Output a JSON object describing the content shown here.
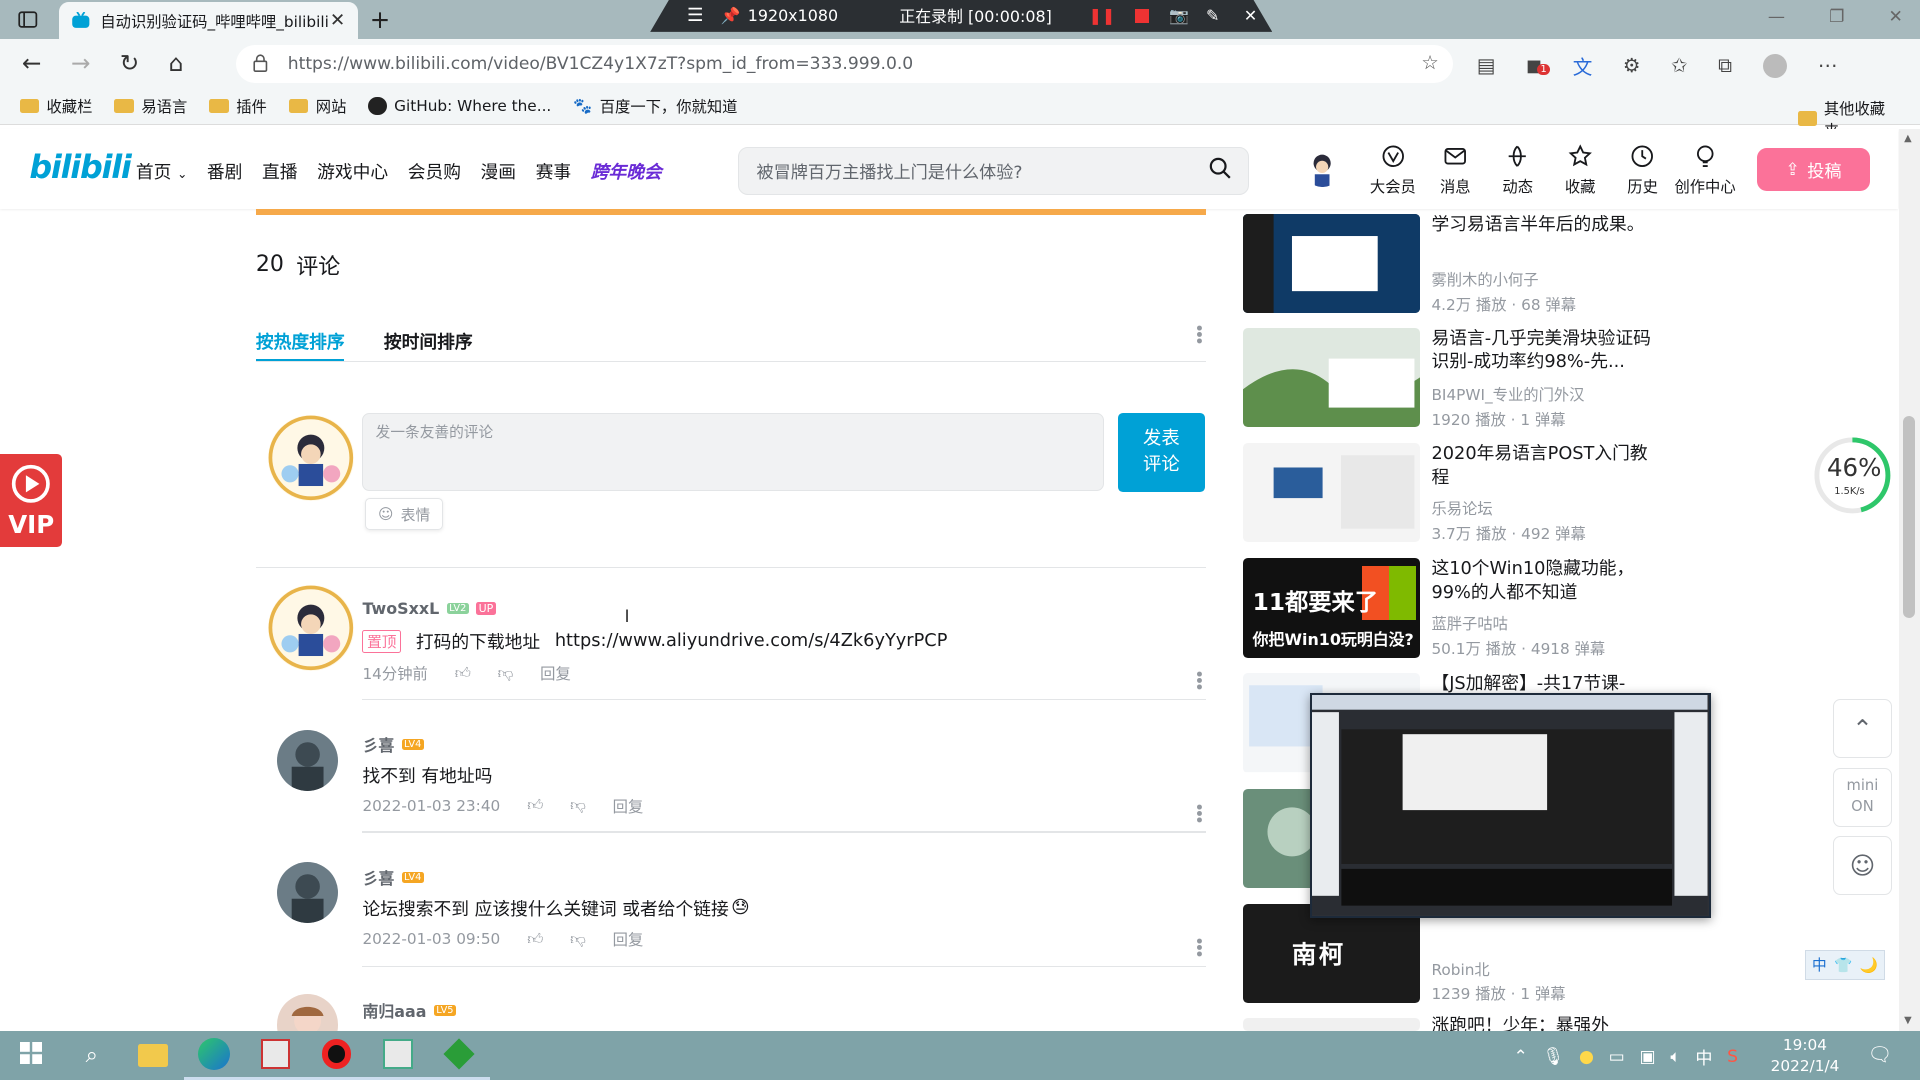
{
  "browser": {
    "tab_title": "自动识别验证码_哔哩哔哩_bilibili",
    "recorder": {
      "resolution": "1920x1080",
      "status": "正在录制 [00:00:08]"
    },
    "url": "https://www.bilibili.com/video/BV1CZ4y1X7zT?spm_id_from=333.999.0.0",
    "bookmarks": [
      "收藏栏",
      "易语言",
      "插件",
      "网站",
      "GitHub: Where the...",
      "百度一下，你就知道"
    ],
    "other_bookmarks": "其他收藏夹"
  },
  "site": {
    "logo": "bilibili",
    "nav": [
      "首页",
      "番剧",
      "直播",
      "游戏中心",
      "会员购",
      "漫画",
      "赛事",
      "跨年晚会"
    ],
    "search_placeholder": "被冒牌百万主播找上门是什么体验?",
    "user_icons": [
      {
        "label": "大会员",
        "icon": "vip-icon"
      },
      {
        "label": "消息",
        "icon": "message-icon"
      },
      {
        "label": "动态",
        "icon": "dynamic-icon"
      },
      {
        "label": "收藏",
        "icon": "star-icon"
      },
      {
        "label": "历史",
        "icon": "history-icon"
      },
      {
        "label": "创作中心",
        "icon": "bulb-icon"
      }
    ],
    "upload_label": "投稿"
  },
  "comments": {
    "count": "20",
    "count_label": "评论",
    "sort_hot": "按热度排序",
    "sort_time": "按时间排序",
    "input_placeholder": "发一条友善的评论",
    "submit_label": "发表\n评论",
    "emoji_label": "表情",
    "reply_label": "回复",
    "items": [
      {
        "user": "TwoSxxL",
        "level": "LV2",
        "badge": "UP",
        "pinned": "置顶",
        "text": "打码的下载地址",
        "link": "https://www.aliyundrive.com/s/4Zk6yYyrPCP",
        "time": "14分钟前"
      },
      {
        "user": "彡喜",
        "level": "LV4",
        "text": "找不到   有地址吗",
        "time": "2022-01-03 23:40"
      },
      {
        "user": "彡喜",
        "level": "LV4",
        "text": "论坛搜索不到   应该搜什么关键词    或者给个链接",
        "time": "2022-01-03 09:50"
      },
      {
        "user": "南归aaa",
        "level": "LV5"
      }
    ]
  },
  "related": [
    {
      "title": "学习易语言半年后的成果。",
      "up": "雾削木的小何子",
      "stats": "4.2万 播放 · 68 弹幕"
    },
    {
      "title": "易语言-几乎完美滑块验证码识别-成功率约98%-先...",
      "up": "BI4PWI_专业的门外汉",
      "stats": "1920 播放 · 1 弹幕"
    },
    {
      "title": "2020年易语言POST入门教程",
      "up": "乐易论坛",
      "stats": "3.7万 播放 · 492 弹幕"
    },
    {
      "title": "这10个Win10隐藏功能，99%的人都不知道",
      "up": "蓝胖子咕咕",
      "stats": "50.1万 播放 · 4918 弹幕",
      "thumb_text": "11都要来了",
      "thumb_sub": "你把Win10玩明白没?"
    },
    {
      "title": "【JS加解密】-共17节课-",
      "up": "",
      "stats": ""
    },
    {
      "title": "",
      "up": "Robin北",
      "stats": "1239 播放 · 1 弹幕",
      "thumb_text": "南柯"
    },
    {
      "title": "涨跑吧！少年：暴强外",
      "up": "",
      "stats": ""
    }
  ],
  "widgets": {
    "vip_label": "VIP",
    "speed_percent": 46,
    "speed_text": "46%",
    "speed_rate": "1.5K/s",
    "mini_label": "mini\nON",
    "ime": [
      "中",
      "👕",
      "🌙"
    ]
  },
  "taskbar": {
    "time": "19:04",
    "date": "2022/1/4",
    "ime": "中"
  }
}
